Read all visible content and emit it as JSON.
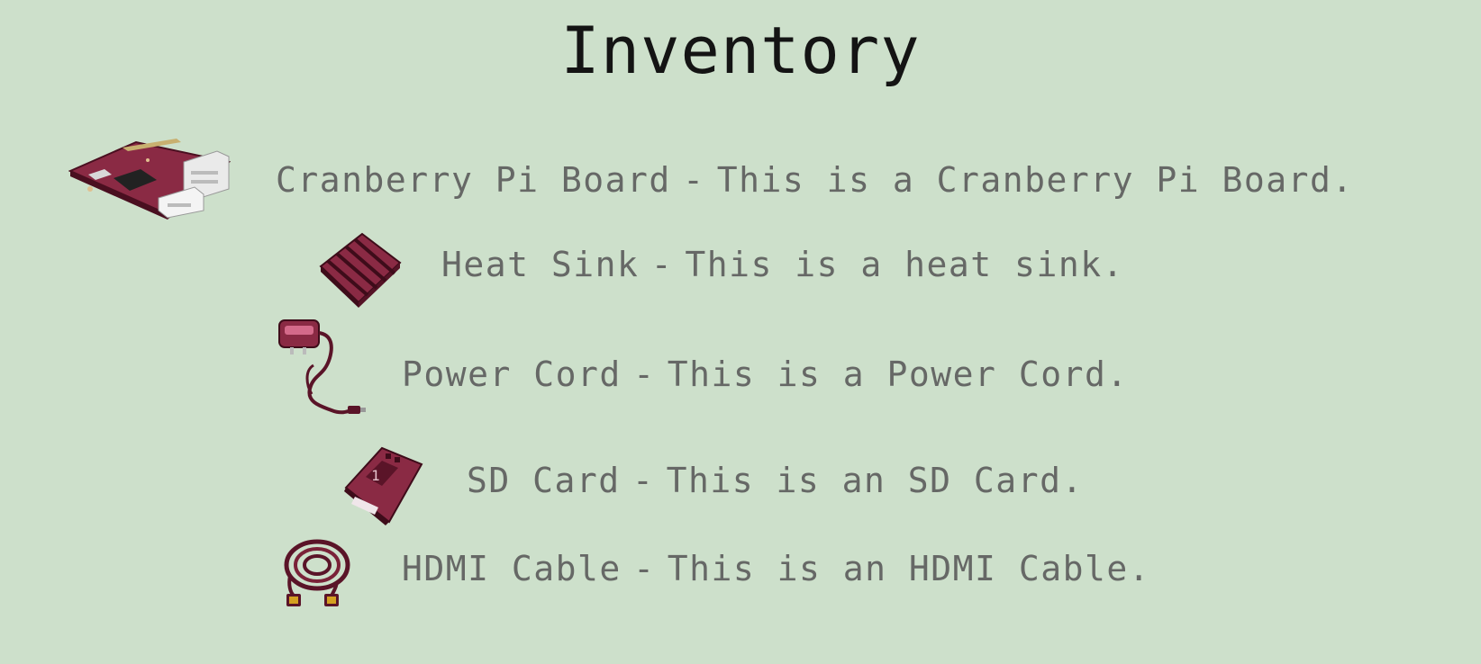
{
  "title": "Inventory",
  "items": [
    {
      "name": "Cranberry Pi Board",
      "description": "This is a Cranberry Pi Board.",
      "icon": "cranberry-pi-board-icon"
    },
    {
      "name": "Heat Sink",
      "description": "This is a heat sink.",
      "icon": "heat-sink-icon"
    },
    {
      "name": "Power Cord",
      "description": "This is a Power Cord.",
      "icon": "power-cord-icon"
    },
    {
      "name": "SD Card",
      "description": "This is an SD Card.",
      "icon": "sd-card-icon"
    },
    {
      "name": "HDMI Cable",
      "description": "This is an HDMI Cable.",
      "icon": "hdmi-cable-icon"
    }
  ],
  "separator": "-",
  "colors": {
    "background": "#cde0cb",
    "title": "#141414",
    "item_text": "#666866",
    "item_maroon": "#6e1f33"
  }
}
